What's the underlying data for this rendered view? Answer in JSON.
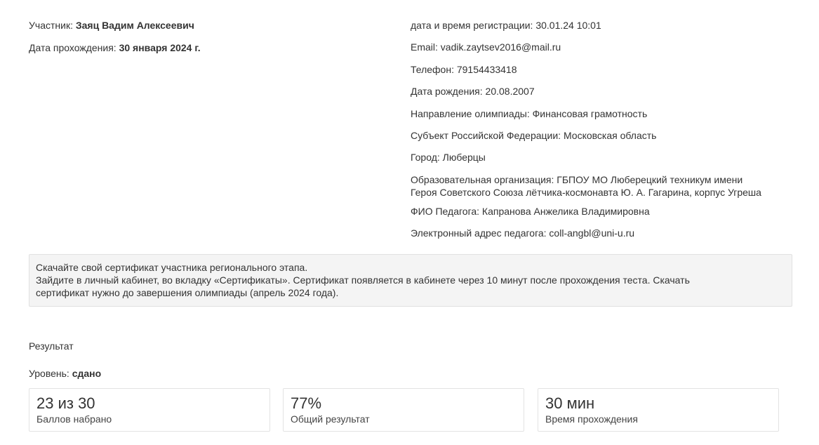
{
  "participant": {
    "label": "Участник:",
    "name": "Заяц Вадим Алексеевич",
    "date_label": "Дата прохождения:",
    "date_value": "30 января 2024 г."
  },
  "details": [
    "дата и время регистрации: 30.01.24 10:01",
    "Email: vadik.zaytsev2016@mail.ru",
    "Телефон: 79154433418",
    "Дата рождения: 20.08.2007",
    "Направление олимпиады: Финансовая грамотность",
    "Субъект Российской Федерации: Московская область",
    "Город: Люберцы",
    "Образовательная организация: ГБПОУ МО Люберецкий техникум имени",
    "Героя Советского Союза лётчика-космонавта Ю. А. Гагарина, корпус Угреша",
    "ФИО Педагога: Капранова Анжелика Владимировна",
    "Электронный адрес педагога: coll-angbl@uni-u.ru"
  ],
  "notice": {
    "line1": "Скачайте свой сертификат участника регионального этапа.",
    "line2": "Зайдите в личный кабинет, во вкладку «Сертификаты». Сертификат появляется в кабинете через 10 минут после прохождения теста. Скачать",
    "line3": "сертификат нужно до завершения олимпиады (апрель 2024 года)."
  },
  "result": {
    "title": "Результат",
    "level_label": "Уровень:",
    "level_value": "сдано",
    "cards": [
      {
        "value": "23 из 30",
        "label": "Баллов набрано"
      },
      {
        "value": "77%",
        "label": "Общий результат"
      },
      {
        "value": "30 мин",
        "label": "Время прохождения"
      }
    ]
  }
}
